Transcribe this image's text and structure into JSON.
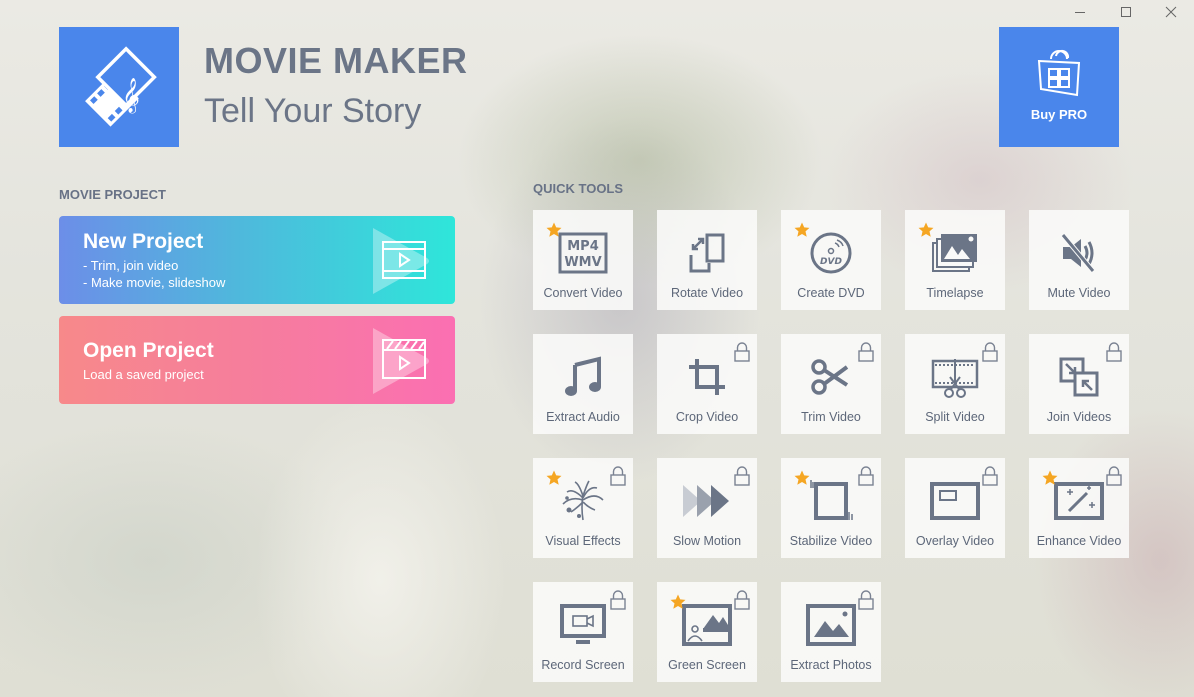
{
  "window": {
    "controls": {
      "minimize": "minimize",
      "maximize": "maximize",
      "close": "close"
    }
  },
  "header": {
    "title": "MOVIE MAKER",
    "subtitle": "Tell Your Story",
    "buy_pro_label": "Buy PRO"
  },
  "movie_project": {
    "section_label": "MOVIE PROJECT",
    "new_project": {
      "title": "New Project",
      "lines": [
        "- Trim, join video",
        "- Make movie, slideshow"
      ]
    },
    "open_project": {
      "title": "Open Project",
      "lines": [
        "Load a saved project"
      ]
    }
  },
  "quick_tools": {
    "section_label": "QUICK TOOLS",
    "tools": [
      {
        "label": "Convert Video",
        "icon": "mp4-wmv-icon",
        "star": true,
        "locked": false
      },
      {
        "label": "Rotate Video",
        "icon": "rotate-icon",
        "star": false,
        "locked": false
      },
      {
        "label": "Create DVD",
        "icon": "dvd-icon",
        "star": true,
        "locked": false
      },
      {
        "label": "Timelapse",
        "icon": "timelapse-icon",
        "star": true,
        "locked": false
      },
      {
        "label": "Mute Video",
        "icon": "mute-icon",
        "star": false,
        "locked": false
      },
      {
        "label": "Extract Audio",
        "icon": "music-note-icon",
        "star": false,
        "locked": false
      },
      {
        "label": "Crop Video",
        "icon": "crop-icon",
        "star": false,
        "locked": true
      },
      {
        "label": "Trim Video",
        "icon": "scissors-icon",
        "star": false,
        "locked": true
      },
      {
        "label": "Split Video",
        "icon": "split-icon",
        "star": false,
        "locked": true
      },
      {
        "label": "Join Videos",
        "icon": "join-icon",
        "star": false,
        "locked": true
      },
      {
        "label": "Visual Effects",
        "icon": "fireworks-icon",
        "star": true,
        "locked": true
      },
      {
        "label": "Slow Motion",
        "icon": "slow-motion-icon",
        "star": false,
        "locked": true
      },
      {
        "label": "Stabilize Video",
        "icon": "stabilize-icon",
        "star": true,
        "locked": true
      },
      {
        "label": "Overlay Video",
        "icon": "overlay-icon",
        "star": false,
        "locked": true
      },
      {
        "label": "Enhance Video",
        "icon": "magic-wand-icon",
        "star": true,
        "locked": true
      },
      {
        "label": "Record Screen",
        "icon": "record-screen-icon",
        "star": false,
        "locked": true
      },
      {
        "label": "Green Screen",
        "icon": "green-screen-icon",
        "star": true,
        "locked": true
      },
      {
        "label": "Extract Photos",
        "icon": "image-icon",
        "star": false,
        "locked": true
      }
    ]
  },
  "colors": {
    "brand_blue": "#4a86eb",
    "text_gray": "#6b7587",
    "star": "#f5a623",
    "icon_gray": "#6b7587"
  }
}
